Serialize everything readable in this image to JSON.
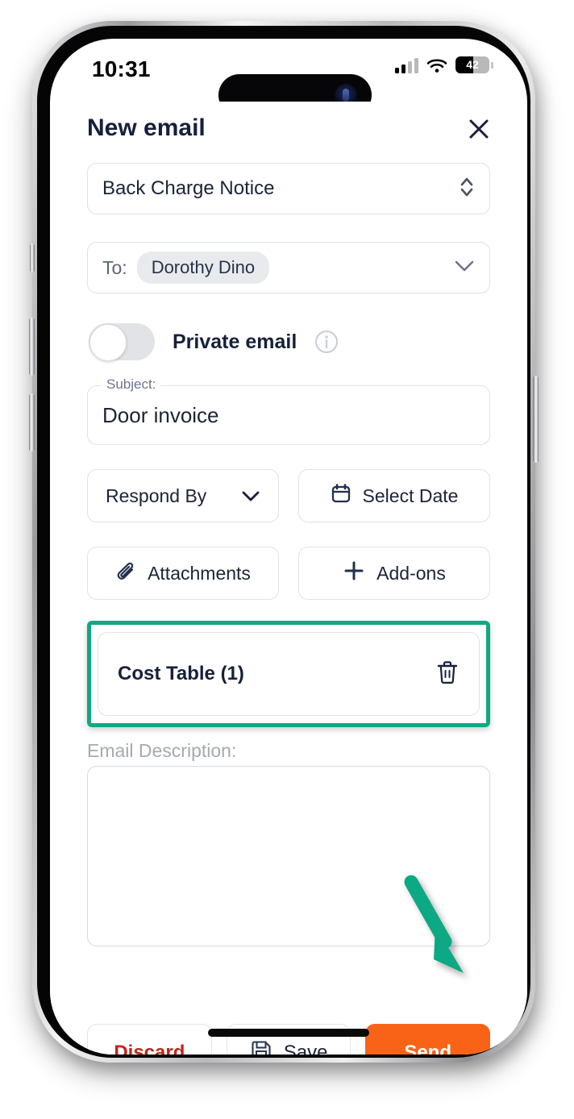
{
  "status_bar": {
    "time": "10:31",
    "cellular_icon": "signal-bars-icon",
    "wifi_icon": "wifi-icon",
    "battery_level": "42",
    "battery_icon": "battery-icon"
  },
  "header": {
    "title": "New email",
    "close_icon": "close-icon"
  },
  "form": {
    "template": {
      "value": "Back Charge Notice",
      "stepper_icon": "chevron-up-down-icon"
    },
    "recipients": {
      "label": "To:",
      "chips": [
        "Dorothy Dino"
      ],
      "expand_icon": "chevron-down-icon"
    },
    "private_email": {
      "label": "Private email",
      "enabled": false,
      "info_icon": "info-icon"
    },
    "subject": {
      "legend": "Subject:",
      "value": "Door invoice",
      "placeholder": "Subject"
    },
    "respond_by": {
      "label": "Respond By",
      "chevron_icon": "chevron-down-icon"
    },
    "select_date": {
      "label": "Select Date",
      "icon": "calendar-icon"
    },
    "attachments": {
      "label": "Attachments",
      "icon": "paperclip-icon"
    },
    "add_ons": {
      "label": "Add-ons",
      "icon": "plus-icon"
    },
    "cost_table": {
      "label": "Cost Table (1)",
      "delete_icon": "trash-icon",
      "highlighted": true
    },
    "description": {
      "label": "Email Description:",
      "value": "",
      "placeholder": ""
    }
  },
  "footer": {
    "discard_label": "Discard",
    "save_label": "Save",
    "save_icon": "floppy-disk-icon",
    "send_label": "Send"
  },
  "annotation": {
    "arrow_icon": "arrow-pointing-down-right-icon",
    "target": "Send"
  },
  "colors": {
    "accent_green": "#10a884",
    "send_orange": "#f96317",
    "discard_red": "#c0261b",
    "text_dark": "#16203a",
    "border_gray": "#dfe2ea"
  }
}
